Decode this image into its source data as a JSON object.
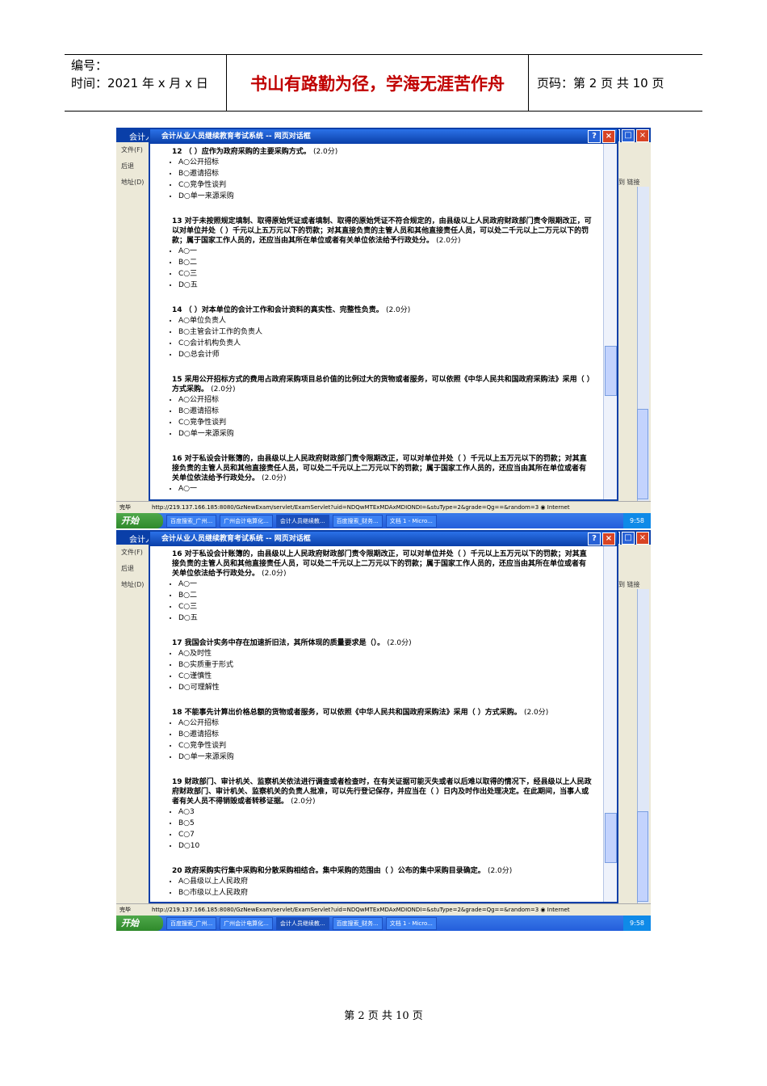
{
  "header": {
    "code_label": "编号：",
    "time_label": "时间：2021 年 x 月 x 日",
    "motto": "书山有路勤为径，学海无涯苦作舟",
    "page_info": "页码：第 2 页 共 10 页"
  },
  "window": {
    "bg_title": "会计人",
    "dialog_title": "会计从业人员继续教育考试系统 -- 网页对话框",
    "left_menu": [
      "文件(F)",
      "后退",
      "地址(D)"
    ],
    "right_labels": [
      "到",
      "链接"
    ],
    "status_done": "完毕",
    "status_url": "http://219.137.166.185:8080/GzNewExam/servlet/ExamServlet?uid=NDQwMTExMDAxMDIONDI=&stuType=2&grade=Qg==&random=3",
    "status_zone": "Internet",
    "start": "开始",
    "taskbar_items": [
      "百度搜索_广州...",
      "广州会计电算化...",
      "会计人员继续教...",
      "百度搜索_财务...",
      "文档 1 - Micro..."
    ],
    "clock": "9:58"
  },
  "shot1": {
    "questions": [
      {
        "text": "12 （ ）应作为政府采购的主要采购方式。",
        "score": "(2.0分)",
        "options": [
          "A○公开招标",
          "B○邀请招标",
          "C○竞争性谈判",
          "D○单一来源采购"
        ]
      },
      {
        "text": "13 对于未按照规定填制、取得原始凭证或者填制、取得的原始凭证不符合规定的，由县级以上人民政府财政部门责令限期改正，可以对单位并处（ ）千元以上五万元以下的罚款；对其直接负责的主管人员和其他直接责任人员，可以处二千元以上二万元以下的罚款；属于国家工作人员的，还应当由其所在单位或者有关单位依法给予行政处分。",
        "score": "(2.0分)",
        "options": [
          "A○一",
          "B○二",
          "C○三",
          "D○五"
        ]
      },
      {
        "text": "14 （ ）对本单位的会计工作和会计资料的真实性、完整性负责。",
        "score": "(2.0分)",
        "options": [
          "A○单位负责人",
          "B○主管会计工作的负责人",
          "C○会计机构负责人",
          "D○总会计师"
        ]
      },
      {
        "text": "15 采用公开招标方式的费用占政府采购项目总价值的比例过大的货物或者服务，可以依照《中华人民共和国政府采购法》采用（ ）方式采购。",
        "score": "(2.0分)",
        "options": [
          "A○公开招标",
          "B○邀请招标",
          "C○竞争性谈判",
          "D○单一来源采购"
        ]
      },
      {
        "text": "16 对于私设会计账簿的，由县级以上人民政府财政部门责令限期改正，可以对单位并处（ ）千元以上五万元以下的罚款；对其直接负责的主管人员和其他直接责任人员，可以处二千元以上二万元以下的罚款；属于国家工作人员的，还应当由其所在单位或者有关单位依法给予行政处分。",
        "score": "(2.0分)",
        "options": [
          "A○一"
        ]
      }
    ]
  },
  "shot2": {
    "top_partial": "16 对于私设会计账簿的，由县级以上人民政府财政部门责令限期改正，可以对单位并处（ ）千元以上五万元以下的罚款；对其直接负责的主管人员和其他直接责任人员，可以处二千元以上二万元以下的罚款；属于国家工作人员的，还应当由其所在单位或者有关单位依法给予行政处分。",
    "top_score": "(2.0分)",
    "top_options": [
      "A○一",
      "B○二",
      "C○三",
      "D○五"
    ],
    "questions": [
      {
        "text": "17 我国会计实务中存在加速折旧法，其所体现的质量要求是（）。",
        "score": "(2.0分)",
        "options": [
          "A○及时性",
          "B○实质重于形式",
          "C○谨慎性",
          "D○可理解性"
        ]
      },
      {
        "text": "18 不能事先计算出价格总额的货物或者服务，可以依照《中华人民共和国政府采购法》采用（ ）方式采购。",
        "score": "(2.0分)",
        "options": [
          "A○公开招标",
          "B○邀请招标",
          "C○竞争性谈判",
          "D○单一来源采购"
        ]
      },
      {
        "text": "19 财政部门、审计机关、监察机关依法进行调查或者检查时，在有关证据可能灭失或者以后难以取得的情况下，经县级以上人民政府财政部门、审计机关、监察机关的负责人批准，可以先行登记保存，并应当在（ ）日内及时作出处理决定。在此期间，当事人或者有关人员不得销毁或者转移证据。",
        "score": "(2.0分)",
        "options": [
          "A○3",
          "B○5",
          "C○7",
          "D○10"
        ]
      },
      {
        "text": "20 政府采购实行集中采购和分散采购相结合。集中采购的范围由（ ）公布的集中采购目录确定。",
        "score": "(2.0分)",
        "options": [
          "A○县级以上人民政府",
          "B○市级以上人民政府"
        ]
      }
    ]
  },
  "footer": "第 2 页 共 10 页"
}
